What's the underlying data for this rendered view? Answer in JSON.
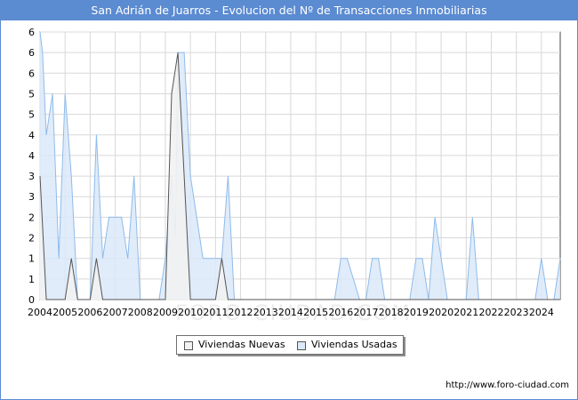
{
  "title": "San Adrián de Juarros - Evolucion del Nº de Transacciones Inmobiliarias",
  "source_url": "http://www.foro-ciudad.com",
  "watermark": "FORO-CIUDAD.COM",
  "colors": {
    "accent": "#5b8bd1",
    "nuevas_fill": "#f2f2f2",
    "nuevas_line": "#555555",
    "usadas_fill": "#dbe9f9",
    "usadas_line": "#8fbbea",
    "grid": "#d8d8d8"
  },
  "chart_data": {
    "type": "area",
    "title": "San Adrián de Juarros - Evolucion del Nº de Transacciones Inmobiliarias",
    "xlabel": "",
    "ylabel": "",
    "x_range": [
      2004,
      2024.75
    ],
    "ylim": [
      0,
      6.5
    ],
    "y_tick_labels": [
      {
        "value": 0,
        "label": "0"
      },
      {
        "value": 0.5,
        "label": "1"
      },
      {
        "value": 1,
        "label": "1"
      },
      {
        "value": 1.5,
        "label": "2"
      },
      {
        "value": 2,
        "label": "2"
      },
      {
        "value": 2.5,
        "label": "3"
      },
      {
        "value": 3,
        "label": "3"
      },
      {
        "value": 3.5,
        "label": "4"
      },
      {
        "value": 4,
        "label": "4"
      },
      {
        "value": 4.5,
        "label": "5"
      },
      {
        "value": 5,
        "label": "5"
      },
      {
        "value": 5.5,
        "label": "6"
      },
      {
        "value": 6,
        "label": "6"
      },
      {
        "value": 6.5,
        "label": "6"
      }
    ],
    "x_ticks": [
      "2004",
      "2005",
      "2006",
      "2007",
      "2008",
      "2009",
      "2010",
      "2011",
      "2012",
      "2013",
      "2014",
      "2015",
      "2016",
      "2017",
      "2018",
      "2019",
      "2020",
      "2021",
      "2022",
      "2023",
      "2024"
    ],
    "grid": true,
    "legend_position": "bottom",
    "series": [
      {
        "name": "Viviendas Nuevas",
        "x": [
          2004.0,
          2004.25,
          2004.5,
          2004.75,
          2005.0,
          2005.25,
          2005.5,
          2005.75,
          2006.0,
          2006.25,
          2006.5,
          2006.75,
          2007.0,
          2007.25,
          2007.5,
          2007.75,
          2008.0,
          2008.25,
          2008.5,
          2008.75,
          2009.0,
          2009.25,
          2009.5,
          2009.75,
          2010.0,
          2010.25,
          2010.5,
          2010.75,
          2011.0,
          2011.25,
          2011.5,
          2011.75,
          2012.0,
          2024.75
        ],
        "values": [
          3,
          0,
          0,
          0,
          0,
          1,
          0,
          0,
          0,
          1,
          0,
          0,
          0,
          0,
          0,
          0,
          0,
          0,
          0,
          0,
          0,
          5,
          6,
          3,
          0,
          0,
          0,
          0,
          0,
          1,
          0,
          0,
          0,
          0
        ]
      },
      {
        "name": "Viviendas Usadas",
        "x": [
          2004.0,
          2004.1,
          2004.25,
          2004.5,
          2004.75,
          2005.0,
          2005.25,
          2005.5,
          2005.75,
          2006.0,
          2006.25,
          2006.5,
          2006.75,
          2007.0,
          2007.25,
          2007.5,
          2007.75,
          2008.0,
          2008.25,
          2008.5,
          2008.75,
          2009.0,
          2009.25,
          2009.4,
          2009.5,
          2009.75,
          2010.0,
          2010.25,
          2010.5,
          2010.75,
          2011.0,
          2011.25,
          2011.5,
          2011.75,
          2012.0,
          2015.5,
          2015.75,
          2016.0,
          2016.25,
          2016.75,
          2017.0,
          2017.25,
          2017.5,
          2017.75,
          2018.0,
          2018.5,
          2018.75,
          2019.0,
          2019.25,
          2019.5,
          2019.75,
          2020.0,
          2020.25,
          2020.5,
          2020.75,
          2021.0,
          2021.25,
          2021.5,
          2023.5,
          2023.75,
          2024.0,
          2024.25,
          2024.5,
          2024.75
        ],
        "values": [
          6.5,
          6,
          4,
          5,
          1,
          5,
          3,
          0,
          0,
          0,
          4,
          1,
          2,
          2,
          2,
          1,
          3,
          0,
          0,
          0,
          0,
          1,
          3,
          1.5,
          6,
          6,
          3,
          2,
          1,
          1,
          1,
          1,
          3,
          0,
          0,
          0,
          0,
          1,
          1,
          0,
          0,
          1,
          1,
          0,
          0,
          0,
          0,
          1,
          1,
          0,
          2,
          1,
          0,
          0,
          0,
          0,
          2,
          0,
          0,
          0,
          1,
          0,
          0,
          1
        ]
      }
    ]
  }
}
